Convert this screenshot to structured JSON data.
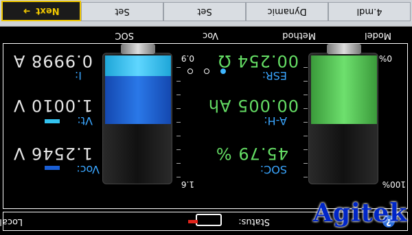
{
  "toolbar": {
    "next_label": "Next",
    "items": [
      "Set",
      "Set",
      "Dynamic",
      "4.mdl"
    ]
  },
  "header": {
    "soc": "SOC",
    "voc": "Voc",
    "method": "Method",
    "model": "Model"
  },
  "left_battery": {
    "top_label": "1.6",
    "bottom_label": "0.9",
    "fill_dark_blue": 0.35,
    "fill_light_blue": 0.15
  },
  "right_battery": {
    "top_label": "100%",
    "bottom_label": "0%",
    "fill_green": 0.46
  },
  "readings_left": {
    "voc_label": "Voc:",
    "voc_value": "1.2546 V",
    "vt_label": "Vt:",
    "vt_value": "1.0010 V",
    "i_label": "I:",
    "i_value": "0.9998 A"
  },
  "readings_right": {
    "soc_label": "SOC:",
    "soc_value": "45.79 %",
    "ah_label": "A-H:",
    "ah_value": "00.005 Ah",
    "esr_label": "ESR:",
    "esr_value": "00.254 Ω"
  },
  "status": {
    "label": "Status:",
    "local": "Local"
  },
  "watermark": "Agitek",
  "colors": {
    "green": "#64dc64",
    "light_blue": "#33c3f0",
    "dark_blue": "#1a5fd6",
    "label_blue": "#3aa6ff",
    "next_yellow": "#f0c700"
  }
}
